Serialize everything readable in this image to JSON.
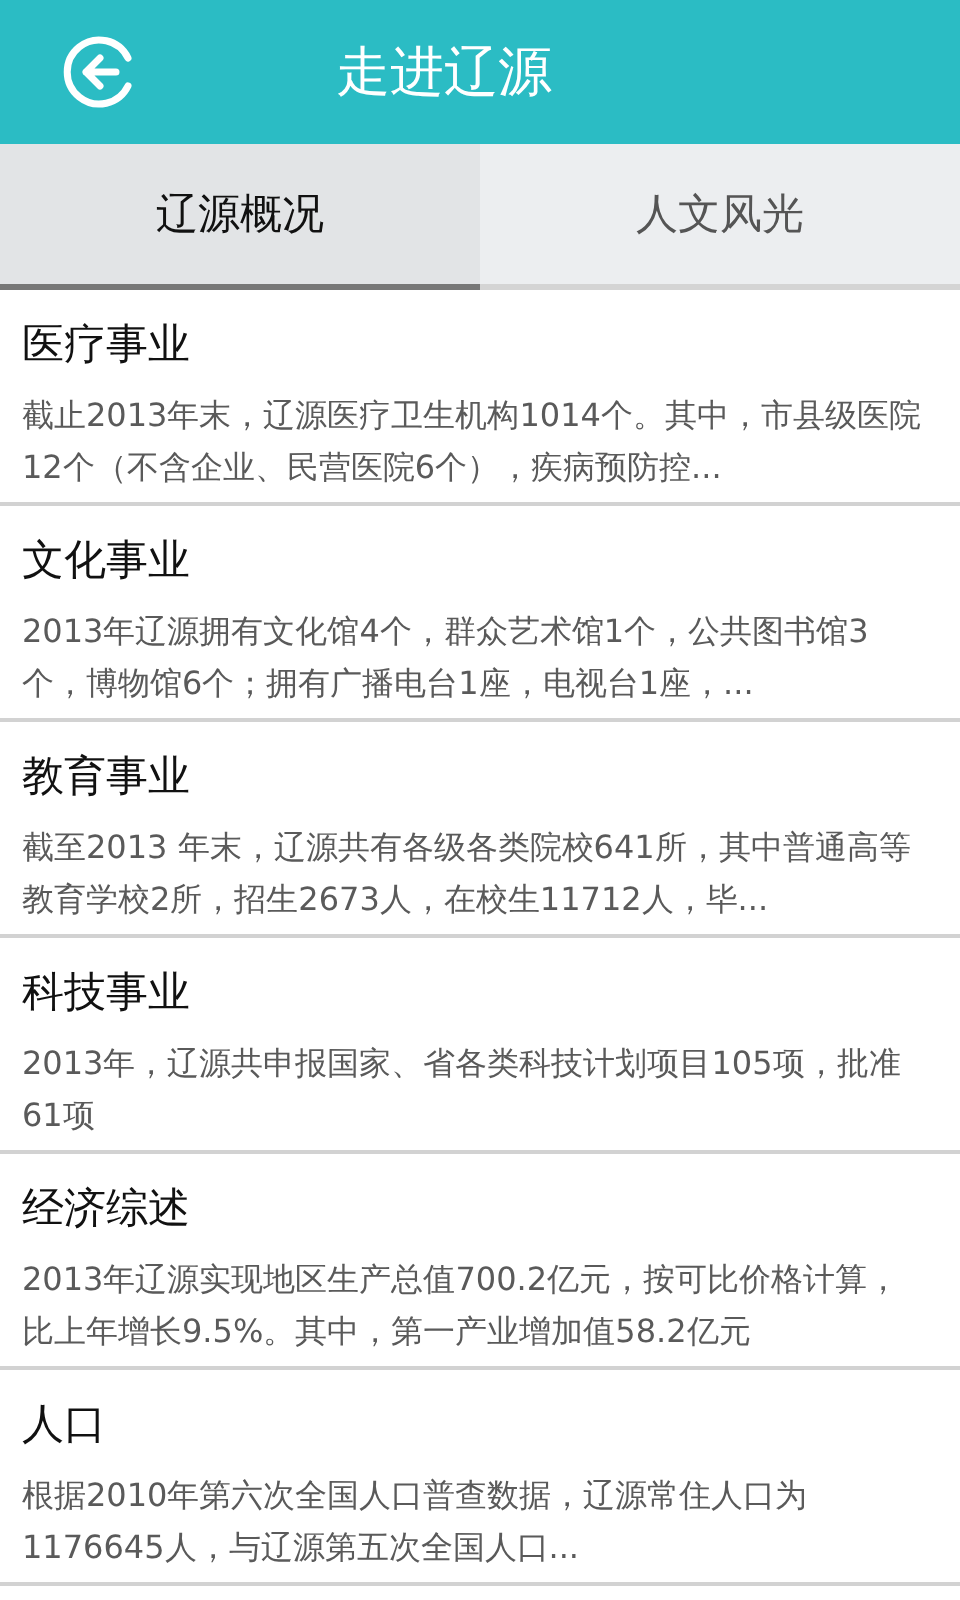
{
  "header": {
    "title": "走进辽源"
  },
  "tabs": [
    {
      "label": "辽源概况",
      "selected": true
    },
    {
      "label": "人文风光",
      "selected": false
    }
  ],
  "items": [
    {
      "title": "医疗事业",
      "summary": "截止2013年末，辽源医疗卫生机构1014个。其中，市县级医院12个（不含企业、民营医院6个），疾病预防控..."
    },
    {
      "title": "文化事业",
      "summary": "2013年辽源拥有文化馆4个，群众艺术馆1个，公共图书馆3个，博物馆6个；拥有广播电台1座，电视台1座，..."
    },
    {
      "title": "教育事业",
      "summary": "截至2013 年末，辽源共有各级各类院校641所，其中普通高等教育学校2所，招生2673人，在校生11712人，毕..."
    },
    {
      "title": "科技事业",
      "summary": "2013年，辽源共申报国家、省各类科技计划项目105项，批准61项"
    },
    {
      "title": "经济综述",
      "summary": "2013年辽源实现地区生产总值700.2亿元，按可比价格计算，比上年增长9.5%。其中，第一产业增加值58.2亿元"
    },
    {
      "title": "人口",
      "summary": "根据2010年第六次全国人口普查数据，辽源常住人口为1176645人，与辽源第五次全国人口..."
    }
  ]
}
